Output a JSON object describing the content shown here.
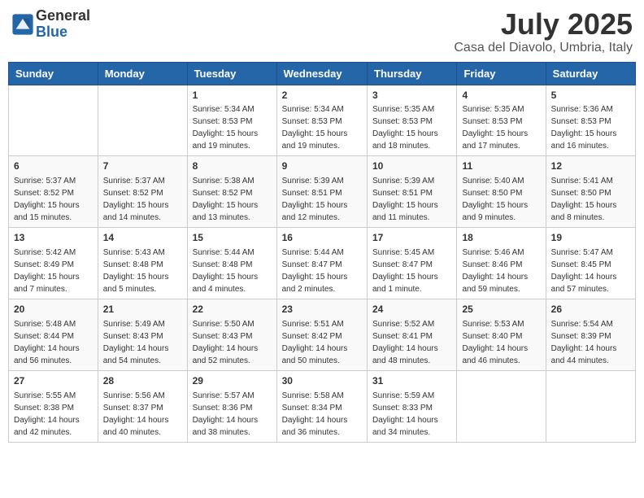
{
  "logo": {
    "general": "General",
    "blue": "Blue"
  },
  "title": "July 2025",
  "location": "Casa del Diavolo, Umbria, Italy",
  "days_of_week": [
    "Sunday",
    "Monday",
    "Tuesday",
    "Wednesday",
    "Thursday",
    "Friday",
    "Saturday"
  ],
  "weeks": [
    [
      {
        "day": "",
        "info": ""
      },
      {
        "day": "",
        "info": ""
      },
      {
        "day": "1",
        "info": "Sunrise: 5:34 AM\nSunset: 8:53 PM\nDaylight: 15 hours and 19 minutes."
      },
      {
        "day": "2",
        "info": "Sunrise: 5:34 AM\nSunset: 8:53 PM\nDaylight: 15 hours and 19 minutes."
      },
      {
        "day": "3",
        "info": "Sunrise: 5:35 AM\nSunset: 8:53 PM\nDaylight: 15 hours and 18 minutes."
      },
      {
        "day": "4",
        "info": "Sunrise: 5:35 AM\nSunset: 8:53 PM\nDaylight: 15 hours and 17 minutes."
      },
      {
        "day": "5",
        "info": "Sunrise: 5:36 AM\nSunset: 8:53 PM\nDaylight: 15 hours and 16 minutes."
      }
    ],
    [
      {
        "day": "6",
        "info": "Sunrise: 5:37 AM\nSunset: 8:52 PM\nDaylight: 15 hours and 15 minutes."
      },
      {
        "day": "7",
        "info": "Sunrise: 5:37 AM\nSunset: 8:52 PM\nDaylight: 15 hours and 14 minutes."
      },
      {
        "day": "8",
        "info": "Sunrise: 5:38 AM\nSunset: 8:52 PM\nDaylight: 15 hours and 13 minutes."
      },
      {
        "day": "9",
        "info": "Sunrise: 5:39 AM\nSunset: 8:51 PM\nDaylight: 15 hours and 12 minutes."
      },
      {
        "day": "10",
        "info": "Sunrise: 5:39 AM\nSunset: 8:51 PM\nDaylight: 15 hours and 11 minutes."
      },
      {
        "day": "11",
        "info": "Sunrise: 5:40 AM\nSunset: 8:50 PM\nDaylight: 15 hours and 9 minutes."
      },
      {
        "day": "12",
        "info": "Sunrise: 5:41 AM\nSunset: 8:50 PM\nDaylight: 15 hours and 8 minutes."
      }
    ],
    [
      {
        "day": "13",
        "info": "Sunrise: 5:42 AM\nSunset: 8:49 PM\nDaylight: 15 hours and 7 minutes."
      },
      {
        "day": "14",
        "info": "Sunrise: 5:43 AM\nSunset: 8:48 PM\nDaylight: 15 hours and 5 minutes."
      },
      {
        "day": "15",
        "info": "Sunrise: 5:44 AM\nSunset: 8:48 PM\nDaylight: 15 hours and 4 minutes."
      },
      {
        "day": "16",
        "info": "Sunrise: 5:44 AM\nSunset: 8:47 PM\nDaylight: 15 hours and 2 minutes."
      },
      {
        "day": "17",
        "info": "Sunrise: 5:45 AM\nSunset: 8:47 PM\nDaylight: 15 hours and 1 minute."
      },
      {
        "day": "18",
        "info": "Sunrise: 5:46 AM\nSunset: 8:46 PM\nDaylight: 14 hours and 59 minutes."
      },
      {
        "day": "19",
        "info": "Sunrise: 5:47 AM\nSunset: 8:45 PM\nDaylight: 14 hours and 57 minutes."
      }
    ],
    [
      {
        "day": "20",
        "info": "Sunrise: 5:48 AM\nSunset: 8:44 PM\nDaylight: 14 hours and 56 minutes."
      },
      {
        "day": "21",
        "info": "Sunrise: 5:49 AM\nSunset: 8:43 PM\nDaylight: 14 hours and 54 minutes."
      },
      {
        "day": "22",
        "info": "Sunrise: 5:50 AM\nSunset: 8:43 PM\nDaylight: 14 hours and 52 minutes."
      },
      {
        "day": "23",
        "info": "Sunrise: 5:51 AM\nSunset: 8:42 PM\nDaylight: 14 hours and 50 minutes."
      },
      {
        "day": "24",
        "info": "Sunrise: 5:52 AM\nSunset: 8:41 PM\nDaylight: 14 hours and 48 minutes."
      },
      {
        "day": "25",
        "info": "Sunrise: 5:53 AM\nSunset: 8:40 PM\nDaylight: 14 hours and 46 minutes."
      },
      {
        "day": "26",
        "info": "Sunrise: 5:54 AM\nSunset: 8:39 PM\nDaylight: 14 hours and 44 minutes."
      }
    ],
    [
      {
        "day": "27",
        "info": "Sunrise: 5:55 AM\nSunset: 8:38 PM\nDaylight: 14 hours and 42 minutes."
      },
      {
        "day": "28",
        "info": "Sunrise: 5:56 AM\nSunset: 8:37 PM\nDaylight: 14 hours and 40 minutes."
      },
      {
        "day": "29",
        "info": "Sunrise: 5:57 AM\nSunset: 8:36 PM\nDaylight: 14 hours and 38 minutes."
      },
      {
        "day": "30",
        "info": "Sunrise: 5:58 AM\nSunset: 8:34 PM\nDaylight: 14 hours and 36 minutes."
      },
      {
        "day": "31",
        "info": "Sunrise: 5:59 AM\nSunset: 8:33 PM\nDaylight: 14 hours and 34 minutes."
      },
      {
        "day": "",
        "info": ""
      },
      {
        "day": "",
        "info": ""
      }
    ]
  ]
}
